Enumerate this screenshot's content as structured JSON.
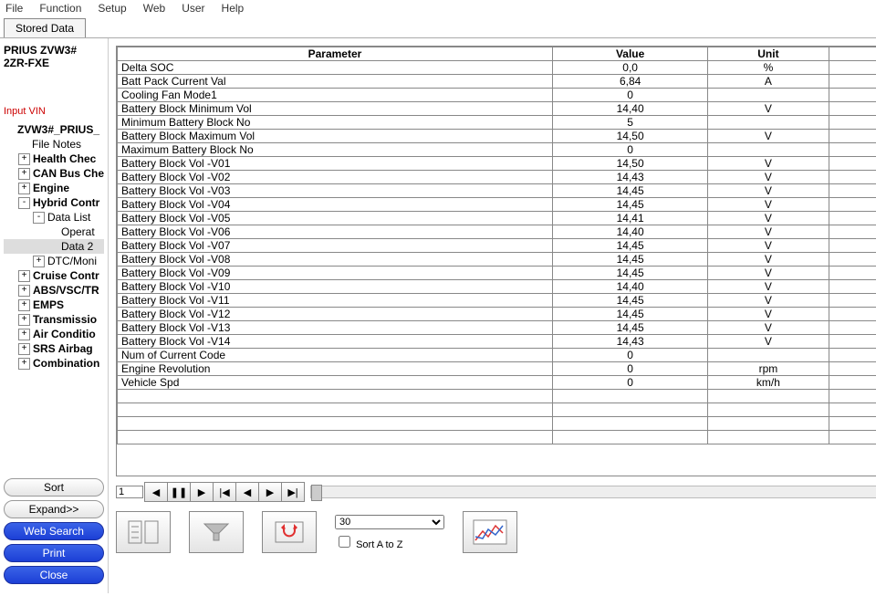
{
  "menu": [
    "File",
    "Function",
    "Setup",
    "Web",
    "User",
    "Help"
  ],
  "tab_label": "Stored Data",
  "vehicle": {
    "name": "PRIUS ZVW3#",
    "engine": "2ZR-FXE"
  },
  "input_vin_label": "Input VIN",
  "tree": [
    {
      "label": "ZVW3#_PRIUS_",
      "indent": 0,
      "bold": true,
      "exp": ""
    },
    {
      "label": "File Notes",
      "indent": 1,
      "bold": false,
      "exp": ""
    },
    {
      "label": "Health Chec",
      "indent": 1,
      "bold": true,
      "exp": "+"
    },
    {
      "label": "CAN Bus Che",
      "indent": 1,
      "bold": true,
      "exp": "+"
    },
    {
      "label": "Engine",
      "indent": 1,
      "bold": true,
      "exp": "+"
    },
    {
      "label": "Hybrid Contr",
      "indent": 1,
      "bold": true,
      "exp": "-"
    },
    {
      "label": "Data List",
      "indent": 2,
      "bold": false,
      "exp": "-"
    },
    {
      "label": "Operat",
      "indent": 3,
      "bold": false,
      "exp": "",
      "sel": false
    },
    {
      "label": "Data 2",
      "indent": 3,
      "bold": false,
      "exp": "",
      "sel": true
    },
    {
      "label": "DTC/Moni",
      "indent": 2,
      "bold": false,
      "exp": "+"
    },
    {
      "label": "Cruise Contr",
      "indent": 1,
      "bold": true,
      "exp": "+"
    },
    {
      "label": "ABS/VSC/TR",
      "indent": 1,
      "bold": true,
      "exp": "+"
    },
    {
      "label": "EMPS",
      "indent": 1,
      "bold": true,
      "exp": "+"
    },
    {
      "label": "Transmissio",
      "indent": 1,
      "bold": true,
      "exp": "+"
    },
    {
      "label": "Air Conditio",
      "indent": 1,
      "bold": true,
      "exp": "+"
    },
    {
      "label": "SRS Airbag",
      "indent": 1,
      "bold": true,
      "exp": "+"
    },
    {
      "label": "Combination",
      "indent": 1,
      "bold": true,
      "exp": "+"
    }
  ],
  "side_buttons": {
    "sort": "Sort",
    "expand": "Expand>>",
    "web": "Web Search",
    "print": "Print",
    "close": "Close"
  },
  "headers": {
    "param": "Parameter",
    "value": "Value",
    "unit": "Unit"
  },
  "rows": [
    {
      "p": "Delta SOC",
      "v": "0,0",
      "u": "%"
    },
    {
      "p": "Batt Pack Current Val",
      "v": "6,84",
      "u": "A"
    },
    {
      "p": "Cooling Fan Mode1",
      "v": "0",
      "u": ""
    },
    {
      "p": "Battery Block Minimum Vol",
      "v": "14,40",
      "u": "V"
    },
    {
      "p": "Minimum Battery Block No",
      "v": "5",
      "u": ""
    },
    {
      "p": "Battery Block Maximum Vol",
      "v": "14,50",
      "u": "V"
    },
    {
      "p": "Maximum Battery Block No",
      "v": "0",
      "u": ""
    },
    {
      "p": "Battery Block Vol -V01",
      "v": "14,50",
      "u": "V"
    },
    {
      "p": "Battery Block Vol -V02",
      "v": "14,43",
      "u": "V"
    },
    {
      "p": "Battery Block Vol -V03",
      "v": "14,45",
      "u": "V"
    },
    {
      "p": "Battery Block Vol -V04",
      "v": "14,45",
      "u": "V"
    },
    {
      "p": "Battery Block Vol -V05",
      "v": "14,41",
      "u": "V"
    },
    {
      "p": "Battery Block Vol -V06",
      "v": "14,40",
      "u": "V"
    },
    {
      "p": "Battery Block Vol -V07",
      "v": "14,45",
      "u": "V"
    },
    {
      "p": "Battery Block Vol -V08",
      "v": "14,45",
      "u": "V"
    },
    {
      "p": "Battery Block Vol -V09",
      "v": "14,45",
      "u": "V"
    },
    {
      "p": "Battery Block Vol -V10",
      "v": "14,40",
      "u": "V"
    },
    {
      "p": "Battery Block Vol -V11",
      "v": "14,45",
      "u": "V"
    },
    {
      "p": "Battery Block Vol -V12",
      "v": "14,45",
      "u": "V"
    },
    {
      "p": "Battery Block Vol -V13",
      "v": "14,45",
      "u": "V"
    },
    {
      "p": "Battery Block Vol -V14",
      "v": "14,43",
      "u": "V"
    },
    {
      "p": "Num of Current Code",
      "v": "0",
      "u": ""
    },
    {
      "p": "Engine Revolution",
      "v": "0",
      "u": "rpm"
    },
    {
      "p": "Vehicle Spd",
      "v": "0",
      "u": "km/h"
    }
  ],
  "blank_rows": 4,
  "playback": {
    "frame": "1"
  },
  "select": {
    "value": "30",
    "sort_label": "Sort A to Z"
  }
}
